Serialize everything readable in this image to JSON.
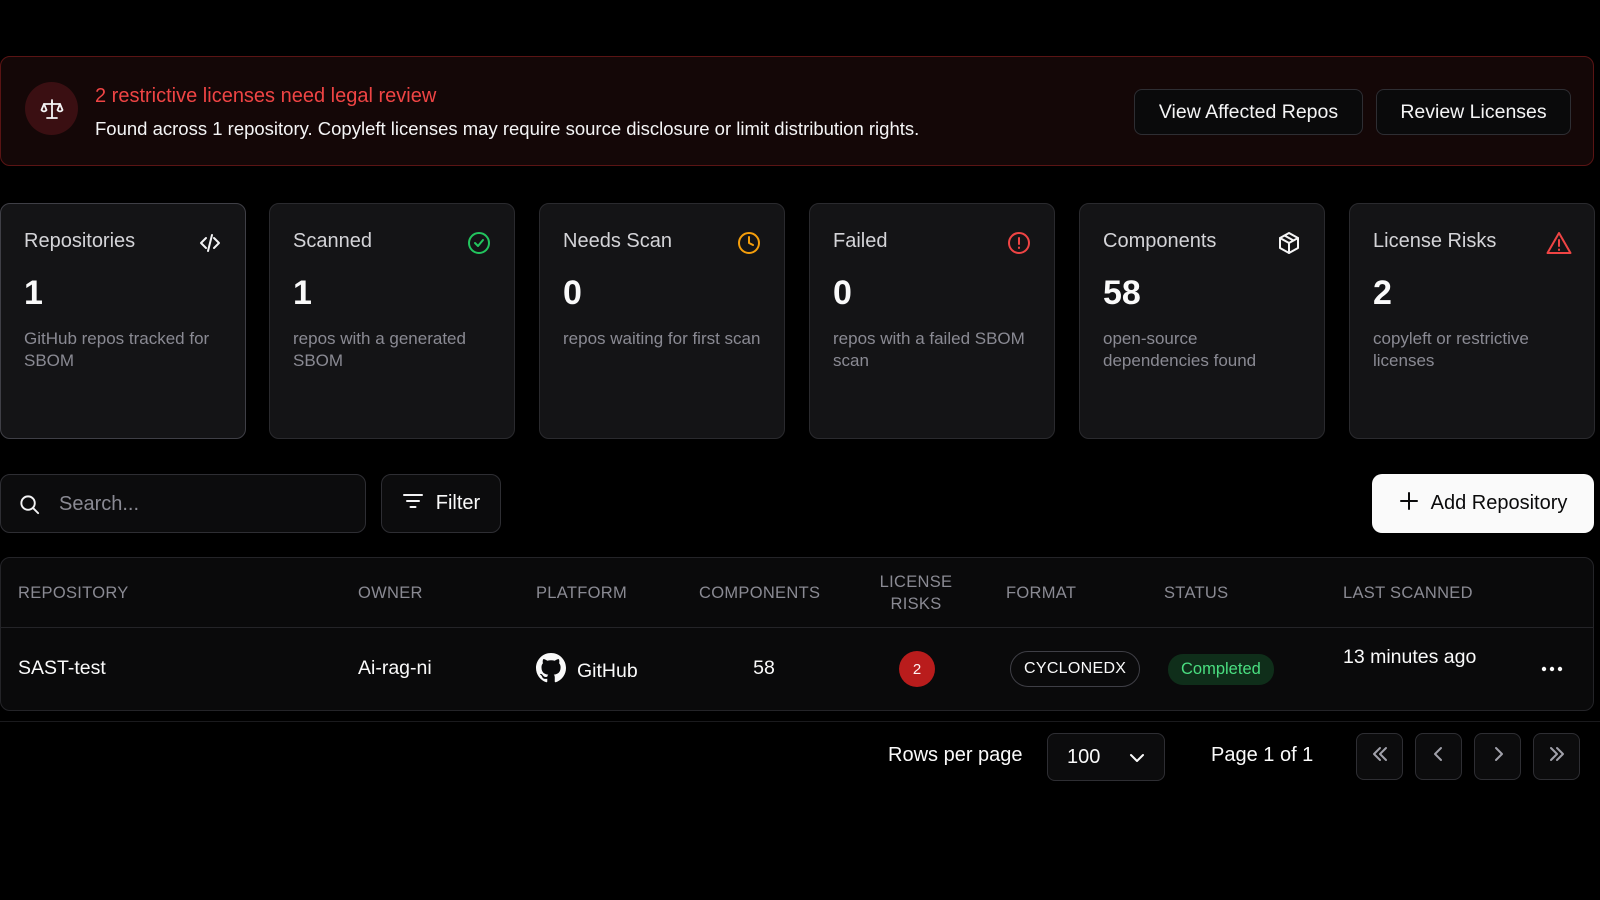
{
  "alert": {
    "title": "2 restrictive licenses need legal review",
    "description": "Found across 1 repository. Copyleft licenses may require source disclosure or limit distribution rights.",
    "icon": "scale-icon",
    "view_button": "View Affected Repos",
    "review_button": "Review Licenses",
    "accent_color": "#ef4444"
  },
  "stats": [
    {
      "title": "Repositories",
      "value": "1",
      "description": "GitHub repos tracked for SBOM",
      "icon": "code-icon"
    },
    {
      "title": "Scanned",
      "value": "1",
      "description": "repos with a generated SBOM",
      "icon": "check-circle-icon",
      "color": "#22c55e"
    },
    {
      "title": "Needs Scan",
      "value": "0",
      "description": "repos waiting for first scan",
      "icon": "clock-icon",
      "color": "#f59e0b"
    },
    {
      "title": "Failed",
      "value": "0",
      "description": "repos with a failed SBOM scan",
      "icon": "alert-circle-icon",
      "color": "#ef4444"
    },
    {
      "title": "Components",
      "value": "58",
      "description": "open-source dependencies found",
      "icon": "package-icon"
    },
    {
      "title": "License Risks",
      "value": "2",
      "description": "copyleft or restrictive licenses",
      "icon": "warning-triangle-icon",
      "color": "#ef4444"
    }
  ],
  "toolbar": {
    "search_placeholder": "Search...",
    "filter_label": "Filter",
    "add_label": "Add Repository"
  },
  "table": {
    "columns": [
      "REPOSITORY",
      "OWNER",
      "PLATFORM",
      "COMPONENTS",
      "LICENSE RISKS",
      "FORMAT",
      "STATUS",
      "LAST SCANNED"
    ],
    "rows": [
      {
        "repository": "SAST-test",
        "owner": "Ai-rag-ni",
        "platform": "GitHub",
        "components": "58",
        "license_risks": "2",
        "format": "CYCLONEDX",
        "status": "Completed",
        "last_scanned": "13 minutes ago"
      }
    ]
  },
  "pagination": {
    "rows_per_page_label": "Rows per page",
    "rows_per_page_value": "100",
    "page_info": "Page 1 of 1"
  }
}
